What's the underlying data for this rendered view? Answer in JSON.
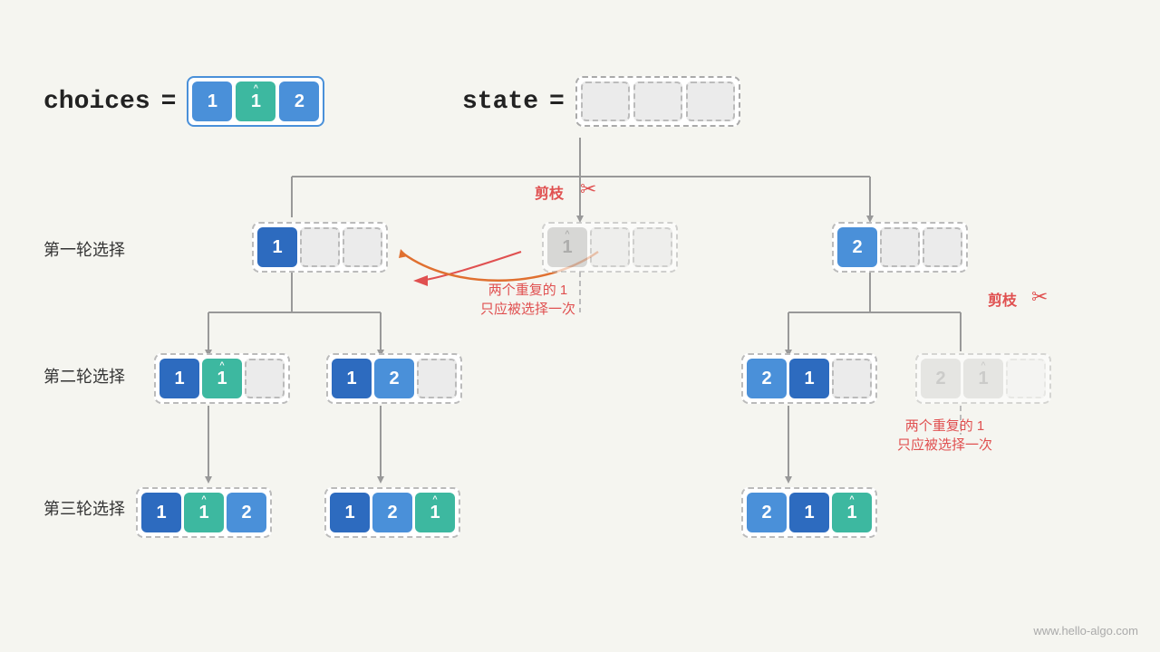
{
  "header": {
    "choices_label": "choices",
    "eq": "=",
    "state_label": "state",
    "choices_values": [
      "1",
      "1̂",
      "2"
    ],
    "prune1_label": "剪枝",
    "prune2_label": "剪枝",
    "note1": "两个重复的 1\n只应被选择一次",
    "note2": "两个重复的 1\n只应被选择一次",
    "row1_label": "第一轮选择",
    "row2_label": "第二轮选择",
    "row3_label": "第三轮选择",
    "watermark": "www.hello-algo.com"
  }
}
